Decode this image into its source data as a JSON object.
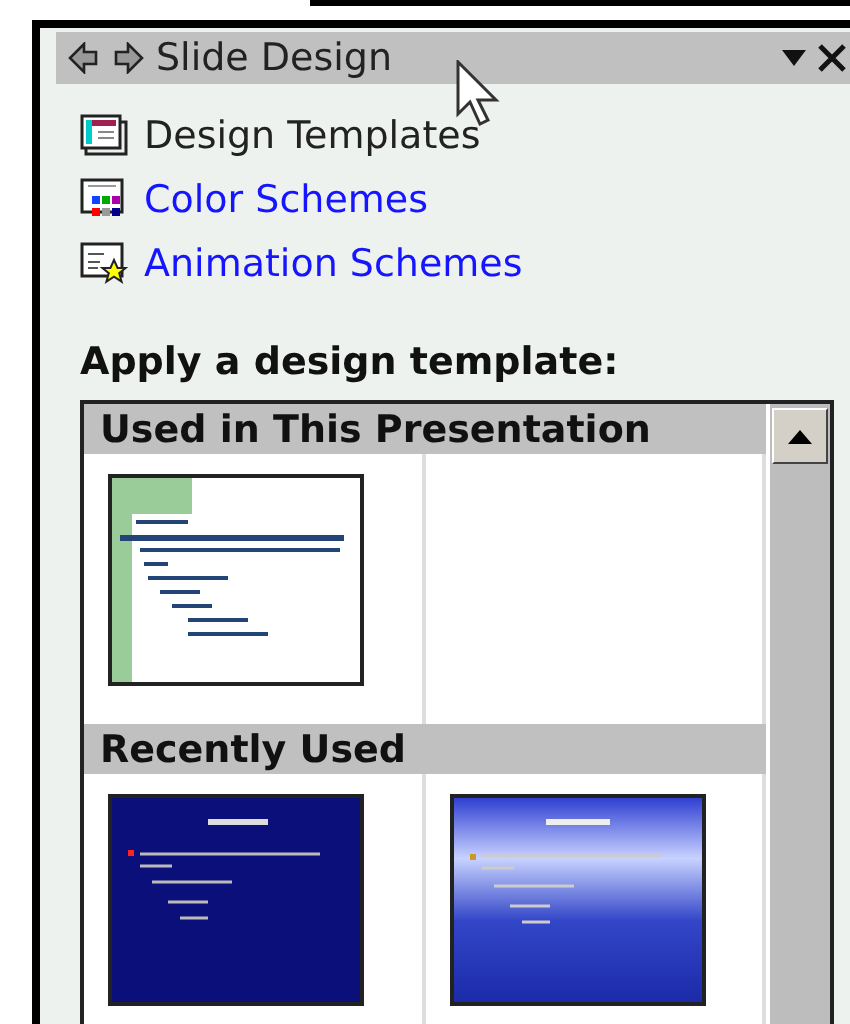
{
  "pane": {
    "title": "Slide Design",
    "tasks": [
      {
        "label": "Design Templates",
        "kind": "current"
      },
      {
        "label": "Color Schemes",
        "kind": "link"
      },
      {
        "label": "Animation Schemes",
        "kind": "link"
      }
    ],
    "section_title": "Apply a design template:",
    "gallery": [
      {
        "heading": "Used in This Presentation",
        "thumbnails": [
          {
            "kind": "white-green"
          }
        ]
      },
      {
        "heading": "Recently Used",
        "thumbnails": [
          {
            "kind": "dark-blue"
          },
          {
            "kind": "blue-sky"
          }
        ]
      }
    ]
  }
}
